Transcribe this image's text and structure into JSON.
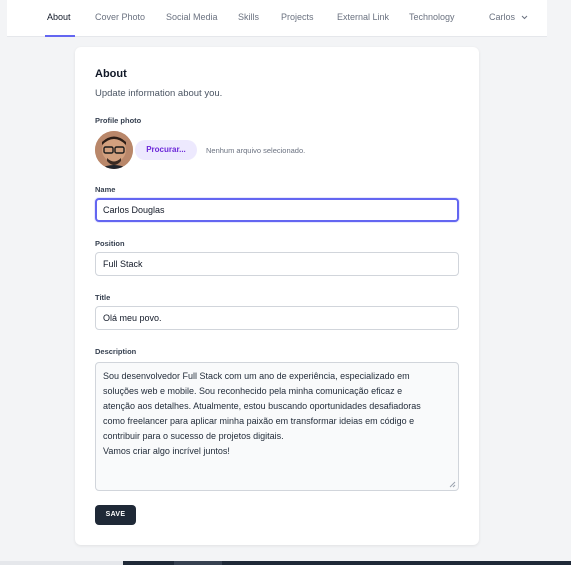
{
  "nav": {
    "tabs": [
      {
        "label": "About",
        "active": true
      },
      {
        "label": "Cover Photo"
      },
      {
        "label": "Social Media"
      },
      {
        "label": "Skills"
      },
      {
        "label": "Projects"
      },
      {
        "label": "External Link"
      },
      {
        "label": "Technology"
      }
    ],
    "user_name": "Carlos",
    "user_icon": "chevron-down-icon",
    "accent_color": "#6366f1"
  },
  "form": {
    "title": "About",
    "subtitle": "Update information about you.",
    "profile_photo": {
      "label": "Profile photo",
      "browse_label": "Procurar...",
      "file_status": "Nenhum arquivo selecionado."
    },
    "name": {
      "label": "Name",
      "value": "Carlos Douglas"
    },
    "position": {
      "label": "Position",
      "value": "Full Stack"
    },
    "title_field": {
      "label": "Title",
      "value": "Olá meu povo."
    },
    "description": {
      "label": "Description",
      "lines": [
        "Sou desenvolvedor Full Stack com um ano de experiência, especializado em",
        "soluções web e mobile. Sou reconhecido pela minha comunicação eficaz e",
        "atenção aos detalhes. Atualmente, estou buscando oportunidades desafiadoras",
        "como freelancer para aplicar minha paixão em transformar ideias em código e",
        "contribuir para o sucesso de projetos digitais.",
        "Vamos criar algo incrível juntos!"
      ]
    },
    "save_label": "SAVE"
  }
}
